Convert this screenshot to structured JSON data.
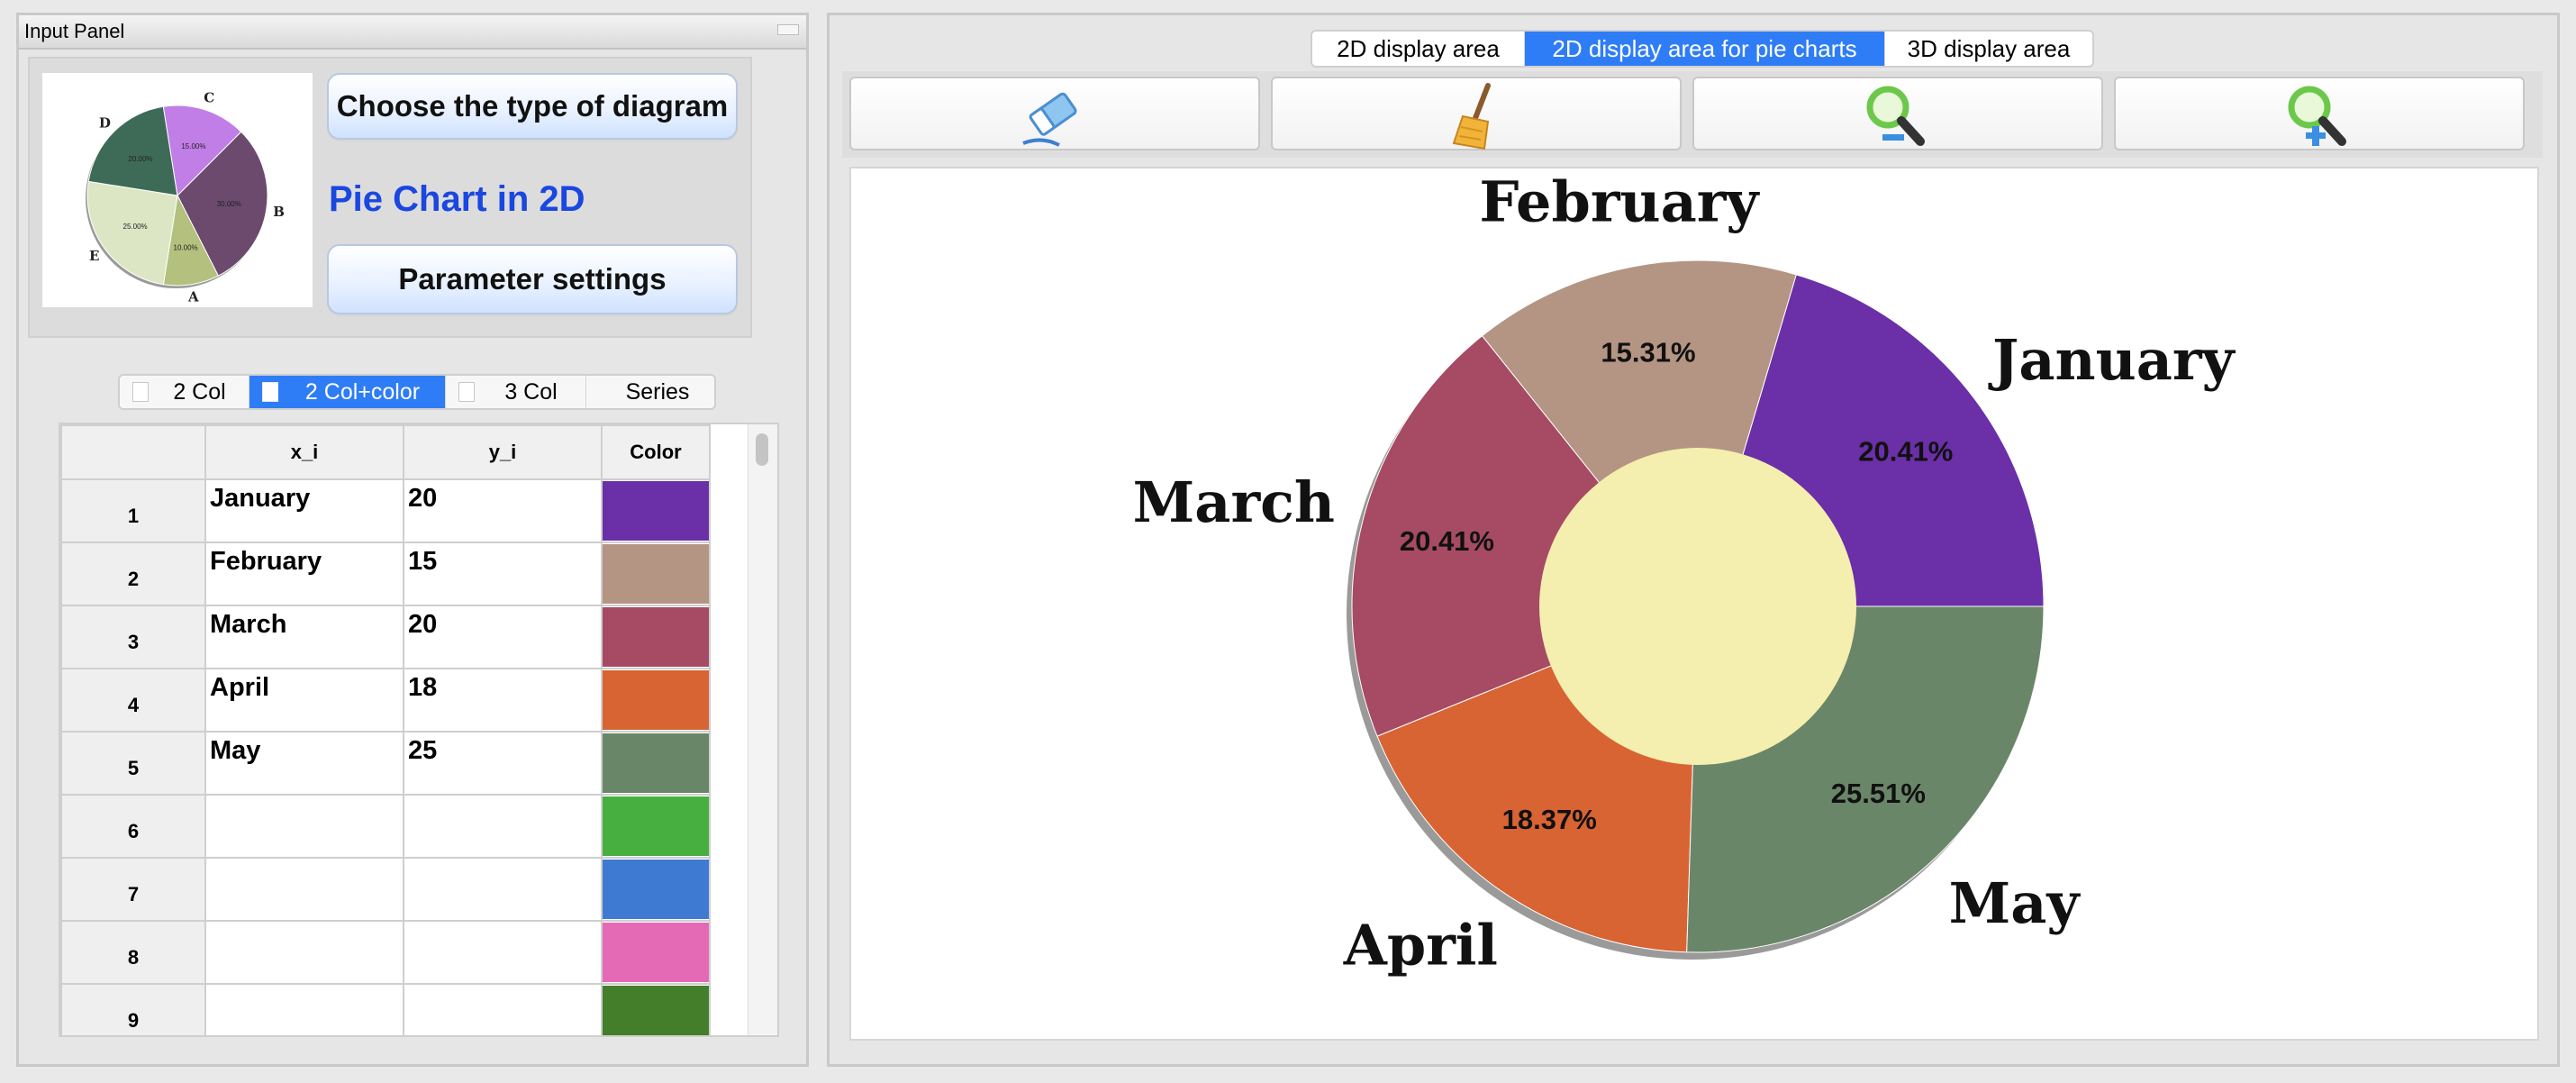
{
  "input_panel": {
    "title": "Input Panel",
    "thumbnail": {
      "slices": [
        {
          "label": "B",
          "percent": "30.00%",
          "color": "#6b4a6e"
        },
        {
          "label": "A",
          "percent": "10.00%",
          "color": "#b4c07e"
        },
        {
          "label": "E",
          "percent": "25.00%",
          "color": "#dce6c4"
        },
        {
          "label": "D",
          "percent": "20.00%",
          "color": "#3e6b57"
        },
        {
          "label": "C",
          "percent": "15.00%",
          "color": "#c17ee6"
        }
      ]
    },
    "choose_button": "Choose the type of diagram",
    "chart_type_label": "Pie Chart in 2D",
    "param_button": "Parameter settings",
    "mode_tabs": [
      "2 Col",
      "2 Col+color",
      "3 Col",
      "Series"
    ],
    "active_mode": "2 Col+color",
    "table": {
      "headers": [
        "",
        "x_i",
        "y_i",
        "Color"
      ],
      "rows": [
        {
          "num": "1",
          "x": "January",
          "y": "20",
          "color": "#6b2fa8"
        },
        {
          "num": "2",
          "x": "February",
          "y": "15",
          "color": "#b49583"
        },
        {
          "num": "3",
          "x": "March",
          "y": "20",
          "color": "#a64b63"
        },
        {
          "num": "4",
          "x": "April",
          "y": "18",
          "color": "#d86333"
        },
        {
          "num": "5",
          "x": "May",
          "y": "25",
          "color": "#6a8669"
        },
        {
          "num": "6",
          "x": "",
          "y": "",
          "color": "#47af3f"
        },
        {
          "num": "7",
          "x": "",
          "y": "",
          "color": "#3e7ad2"
        },
        {
          "num": "8",
          "x": "",
          "y": "",
          "color": "#e56ab5"
        },
        {
          "num": "9",
          "x": "",
          "y": "",
          "color": "#457e2a"
        }
      ]
    }
  },
  "display_panel": {
    "tabs": [
      "2D display area",
      "2D display area for pie charts",
      "3D display area"
    ],
    "active_tab": "2D display area for pie charts",
    "toolbar": [
      {
        "name": "eraser-tool-button",
        "icon": "eraser-icon"
      },
      {
        "name": "clear-broom-button",
        "icon": "broom-icon"
      },
      {
        "name": "zoom-out-button",
        "icon": "zoom-out-icon"
      },
      {
        "name": "zoom-in-button",
        "icon": "zoom-in-icon"
      }
    ]
  },
  "chart_data": {
    "type": "pie",
    "donut": true,
    "hole_color": "#f4efae",
    "slices": [
      {
        "label": "January",
        "value": 20,
        "percent_label": "20.41%",
        "color": "#6b2fa8"
      },
      {
        "label": "February",
        "value": 15,
        "percent_label": "15.31%",
        "color": "#b49583"
      },
      {
        "label": "March",
        "value": 20,
        "percent_label": "20.41%",
        "color": "#a64b63"
      },
      {
        "label": "April",
        "value": 18,
        "percent_label": "18.37%",
        "color": "#d86333"
      },
      {
        "label": "May",
        "value": 25,
        "percent_label": "25.51%",
        "color": "#6a8669"
      }
    ]
  }
}
